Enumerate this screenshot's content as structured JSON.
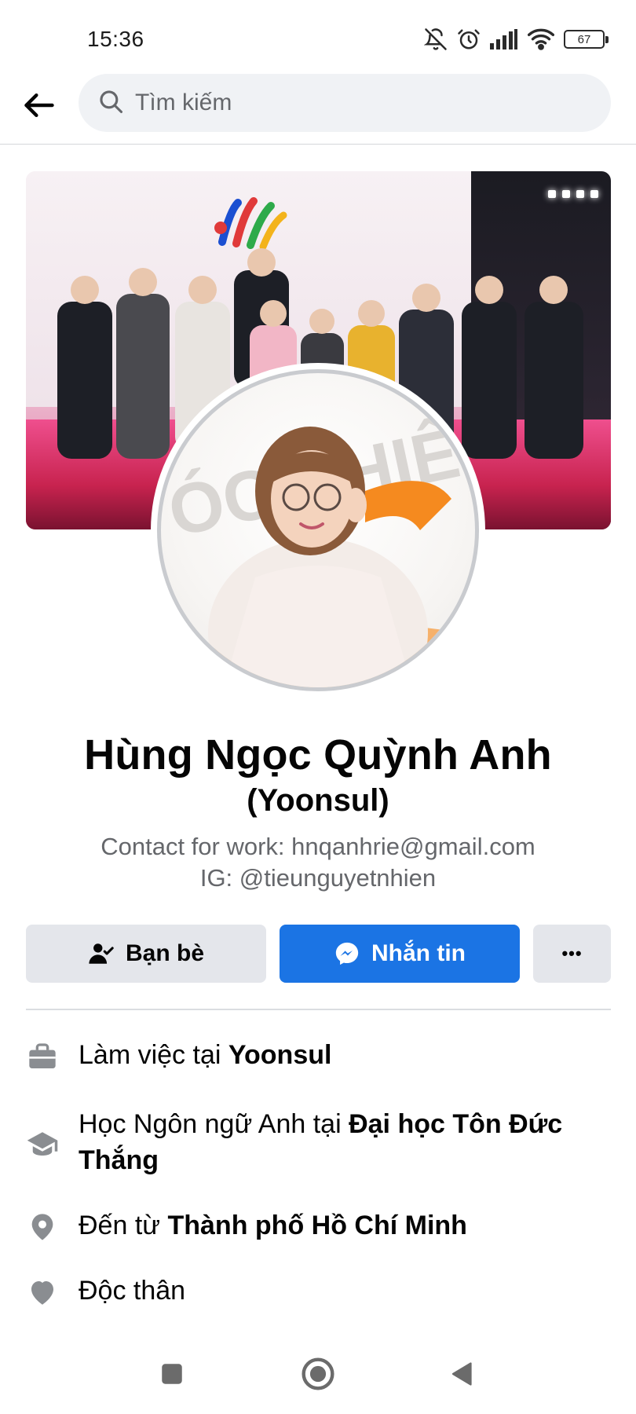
{
  "status_bar": {
    "time": "15:36",
    "battery": "67",
    "icons": [
      "bell-off-icon",
      "alarm-icon",
      "signal-icon",
      "wifi-icon",
      "battery-icon"
    ]
  },
  "header": {
    "back_icon": "arrow-left-icon",
    "search_placeholder": "Tìm kiếm",
    "search_icon": "search-icon"
  },
  "profile": {
    "name": "Hùng Ngọc Quỳnh Anh",
    "alternate_name": "(Yoonsul)",
    "bio_line1": "Contact for work: hnqanhrie@gmail.com",
    "bio_line2": "IG: @tieunguyetnhien"
  },
  "actions": {
    "friends_label": "Bạn bè",
    "message_label": "Nhắn tin",
    "more_label": "•••"
  },
  "details": [
    {
      "icon": "briefcase-icon",
      "prefix": "Làm việc tại ",
      "value": "Yoonsul"
    },
    {
      "icon": "graduation-cap-icon",
      "prefix": "Học Ngôn ngữ Anh tại ",
      "value": "Đại học Tôn Đức Thắng"
    },
    {
      "icon": "location-pin-icon",
      "prefix": "Đến từ ",
      "value": "Thành phố Hồ Chí Minh"
    },
    {
      "icon": "heart-icon",
      "prefix": "Độc thân",
      "value": ""
    }
  ],
  "colors": {
    "primary": "#1b74e4",
    "secondary_button": "#e4e6eb",
    "muted_text": "#65676b"
  }
}
